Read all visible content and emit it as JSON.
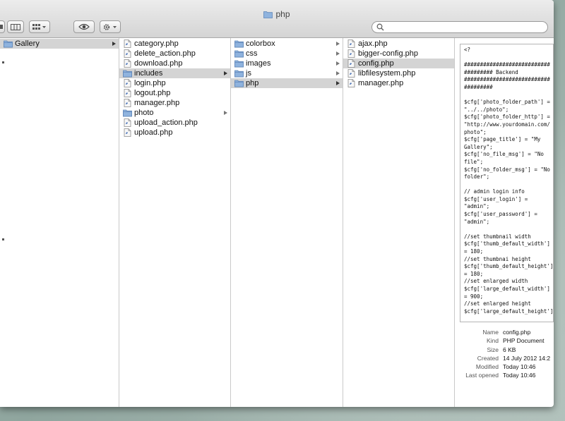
{
  "window": {
    "title": "php"
  },
  "search": {
    "value": "",
    "placeholder": ""
  },
  "columns": [
    {
      "items": [
        {
          "label": "Gallery",
          "type": "folder",
          "selected": true,
          "has_children": true
        }
      ]
    },
    {
      "items": [
        {
          "label": "category.php",
          "type": "php",
          "selected": false,
          "has_children": false
        },
        {
          "label": "delete_action.php",
          "type": "php",
          "selected": false,
          "has_children": false
        },
        {
          "label": "download.php",
          "type": "php",
          "selected": false,
          "has_children": false
        },
        {
          "label": "includes",
          "type": "folder",
          "selected": true,
          "has_children": true
        },
        {
          "label": "login.php",
          "type": "php",
          "selected": false,
          "has_children": false
        },
        {
          "label": "logout.php",
          "type": "php",
          "selected": false,
          "has_children": false
        },
        {
          "label": "manager.php",
          "type": "php",
          "selected": false,
          "has_children": false
        },
        {
          "label": "photo",
          "type": "folder",
          "selected": false,
          "has_children": true
        },
        {
          "label": "upload_action.php",
          "type": "php",
          "selected": false,
          "has_children": false
        },
        {
          "label": "upload.php",
          "type": "php",
          "selected": false,
          "has_children": false
        }
      ]
    },
    {
      "items": [
        {
          "label": "colorbox",
          "type": "folder",
          "selected": false,
          "has_children": true
        },
        {
          "label": "css",
          "type": "folder",
          "selected": false,
          "has_children": true
        },
        {
          "label": "images",
          "type": "folder",
          "selected": false,
          "has_children": true
        },
        {
          "label": "js",
          "type": "folder",
          "selected": false,
          "has_children": true
        },
        {
          "label": "php",
          "type": "folder",
          "selected": true,
          "has_children": true
        }
      ]
    },
    {
      "items": [
        {
          "label": "ajax.php",
          "type": "php",
          "selected": false,
          "has_children": false
        },
        {
          "label": "bigger-config.php",
          "type": "php",
          "selected": false,
          "has_children": false
        },
        {
          "label": "config.php",
          "type": "php",
          "selected": true,
          "has_children": false
        },
        {
          "label": "libfilesystem.php",
          "type": "php",
          "selected": false,
          "has_children": false
        },
        {
          "label": "manager.php",
          "type": "php",
          "selected": false,
          "has_children": false
        }
      ]
    }
  ],
  "preview": {
    "code_lines": [
      "<?",
      "",
      "###########################",
      "######### Backend",
      "###########################",
      "#########",
      "",
      "$cfg['photo_folder_path'] =",
      "\"../../photo\";",
      "$cfg['photo_folder_http'] =",
      "\"http://www.yourdomain.com/",
      "photo\";",
      "$cfg['page_title'] = \"My",
      "Gallery\";",
      "$cfg['no_file_msg'] = \"No",
      "file\";",
      "$cfg['no_folder_msg'] = \"No",
      "folder\";",
      "",
      "// admin login info",
      "$cfg['user_login'] =",
      "\"admin\";",
      "$cfg['user_password'] =",
      "\"admin\";",
      "",
      "//set thumbnail width",
      "$cfg['thumb_default_width']",
      "= 180;",
      "//set thumbnai height",
      "$cfg['thumb_default_height']",
      "= 180;",
      "//set enlarged width",
      "$cfg['large_default_width']",
      "= 900;",
      "//set enlarged height",
      "$cfg['large_default_height']"
    ]
  },
  "info": [
    {
      "key": "Name",
      "value": "config.php"
    },
    {
      "key": "Kind",
      "value": "PHP Document"
    },
    {
      "key": "Size",
      "value": "6 KB"
    },
    {
      "key": "Created",
      "value": "14 July 2012 14:2"
    },
    {
      "key": "Modified",
      "value": "Today 10:46"
    },
    {
      "key": "Last opened",
      "value": "Today 10:46"
    }
  ],
  "icons": {
    "folder_color": "#8fb3de",
    "php_doc": "php-document-icon"
  }
}
